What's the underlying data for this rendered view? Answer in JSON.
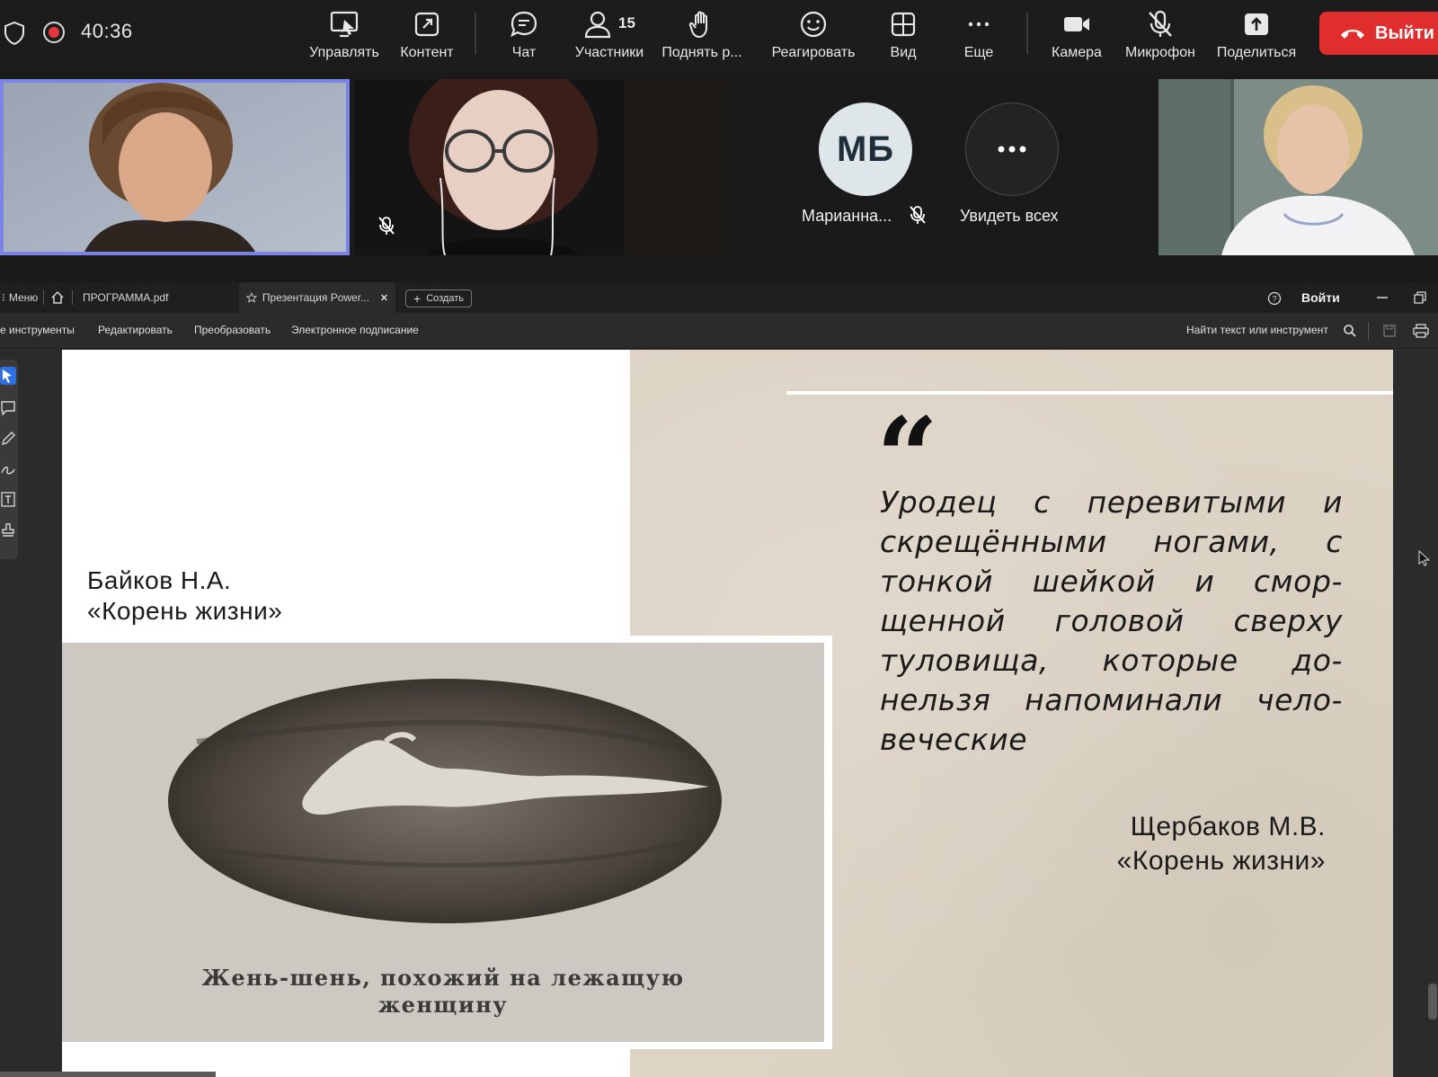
{
  "meeting": {
    "timer": "40:36",
    "toolbar": {
      "manage": "Управлять",
      "content": "Контент",
      "chat": "Чат",
      "participants": "Участники",
      "participants_count": "15",
      "raise_hand": "Поднять р...",
      "react": "Реагировать",
      "view": "Вид",
      "more": "Еще",
      "camera": "Камера",
      "microphone": "Микрофон",
      "share": "Поделиться",
      "leave": "Выйти"
    },
    "participants": {
      "avatar_initials": "МБ",
      "avatar_name": "Марианна...",
      "see_all": "Увидеть всех"
    },
    "colors": {
      "leave": "#e02d2d",
      "active_speaker": "#7b84e6",
      "record": "#e5383b"
    }
  },
  "pdf": {
    "tabs": {
      "menu": "Меню",
      "file1": "ПРОГРАММА.pdf",
      "file2": "Презентация Power...",
      "create": "Создать"
    },
    "sign_in": "Войти",
    "menu": {
      "tools": "е инструменты",
      "edit": "Редактировать",
      "convert": "Преобразовать",
      "esign": "Электронное подписание",
      "find": "Найти текст или инструмент"
    },
    "slide": {
      "left_author": "Байков Н.А.",
      "left_title": "«Корень жизни»",
      "photo_caption_line1": "Жень-шень, похожий  на лежащую",
      "photo_caption_line2": "женщину",
      "quote_mark": "“",
      "quote": "Уродец с перевитыми и скрещёнными ногами, с тонкой шейкой и смор-щенной головой сверху туловища, которые до-нельзя напоминали чело-веческие",
      "right_author": "Щербаков М.В.",
      "right_title": "«Корень жизни»"
    }
  }
}
